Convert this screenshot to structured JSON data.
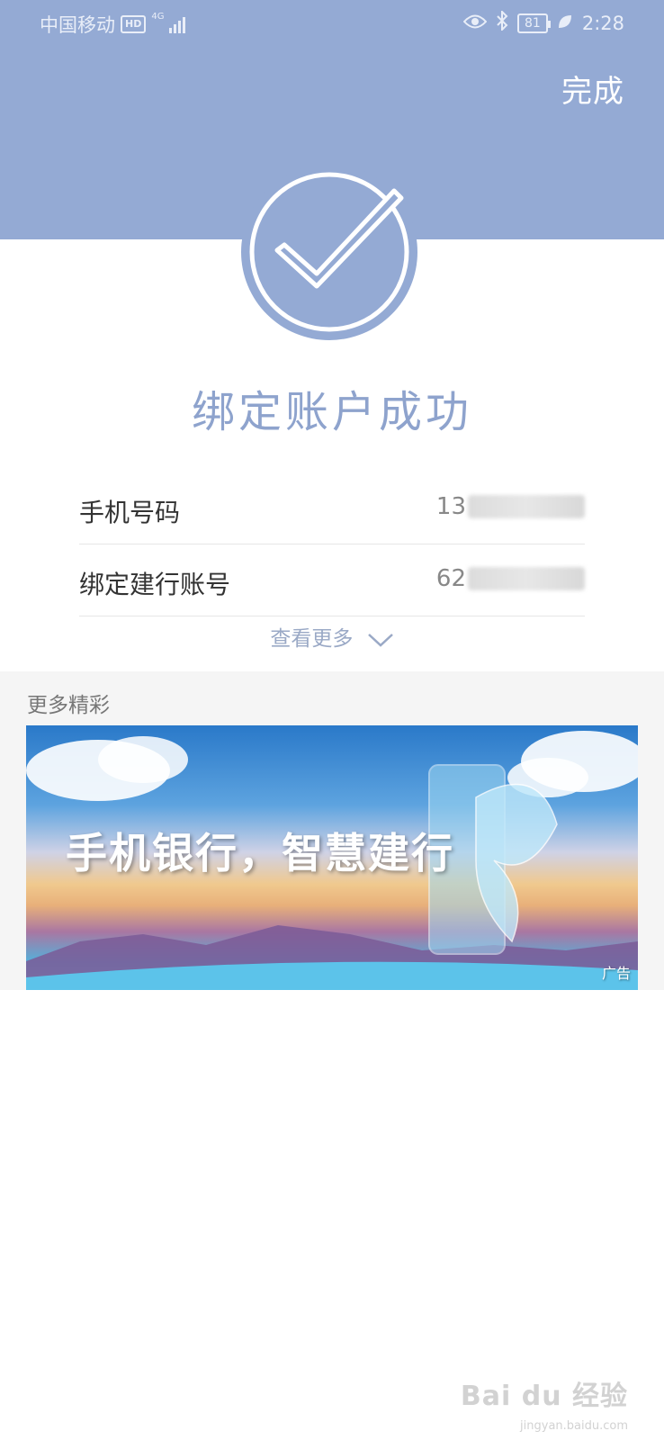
{
  "status_bar": {
    "carrier": "中国移动",
    "hd_badge": "HD",
    "network": "4G",
    "battery": "81",
    "time": "2:28"
  },
  "header": {
    "done_label": "完成",
    "accent_color": "#94aad4"
  },
  "result": {
    "title": "绑定账户成功",
    "icon": "check-circle-icon"
  },
  "info": {
    "rows": [
      {
        "label": "手机号码",
        "value_visible": "13"
      },
      {
        "label": "绑定建行账号",
        "value_visible": "62"
      }
    ],
    "view_more_label": "查看更多"
  },
  "more_section": {
    "title": "更多精彩",
    "banner": {
      "headline": "手机银行，智慧建行",
      "ad_label": "广告"
    }
  },
  "watermark": {
    "text": "Bai du 经验",
    "sub": "jingyan.baidu.com"
  }
}
